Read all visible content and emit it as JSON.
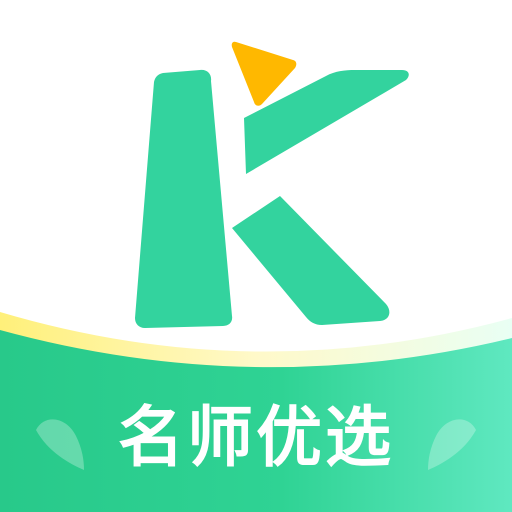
{
  "app_icon": {
    "logo_letter": "K",
    "slogan": "名师优选",
    "colors": {
      "brand_green": "#33d39e",
      "banner_green_dark": "#2ccd8c",
      "banner_green_light": "#4fe3b6",
      "accent_yellow": "#ffb800",
      "glow_yellow": "#fff3a6",
      "background": "#ffffff"
    },
    "icons": [
      "k-logo-mark",
      "play-triangle-icon",
      "leaf-icon"
    ]
  }
}
